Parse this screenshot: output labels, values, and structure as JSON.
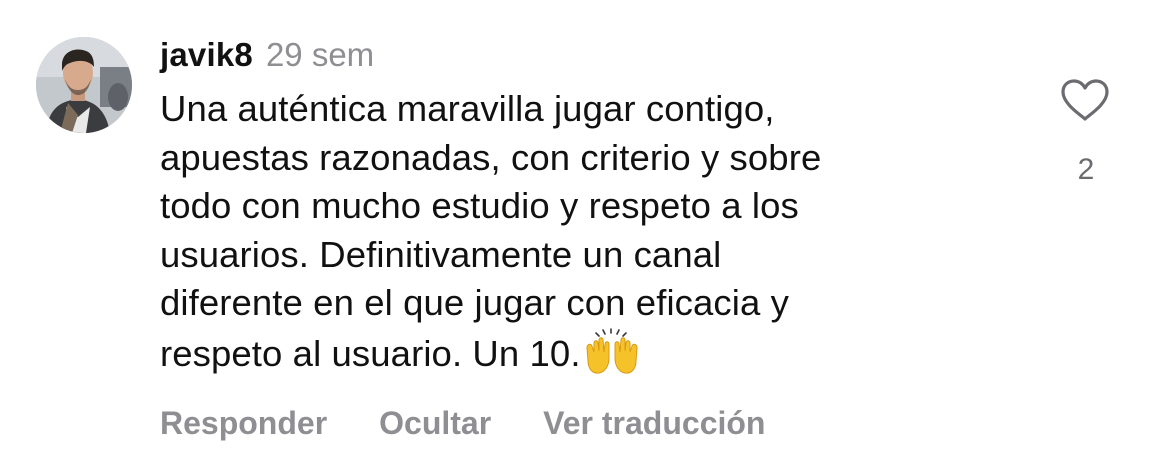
{
  "comment": {
    "username": "javik8",
    "time": "29 sem",
    "text": "Una auténtica maravilla jugar contigo,\napuestas razonadas, con criterio y sobre\ntodo con mucho estudio y respeto a los\nusuarios. Definitivamente un canal\ndiferente en el que jugar con eficacia y\nrespeto al usuario. Un 10.",
    "emoji": "raising-hands-emoji",
    "likes": "2"
  },
  "actions": {
    "reply": "Responder",
    "hide": "Ocultar",
    "translate": "Ver traducción"
  },
  "icons": {
    "like": "heart-outline-icon",
    "avatar": "user-profile-photo"
  },
  "colors": {
    "text": "#111111",
    "secondary": "#8e8e93",
    "heart": "#6b6b70",
    "emoji": "#f6c229"
  }
}
